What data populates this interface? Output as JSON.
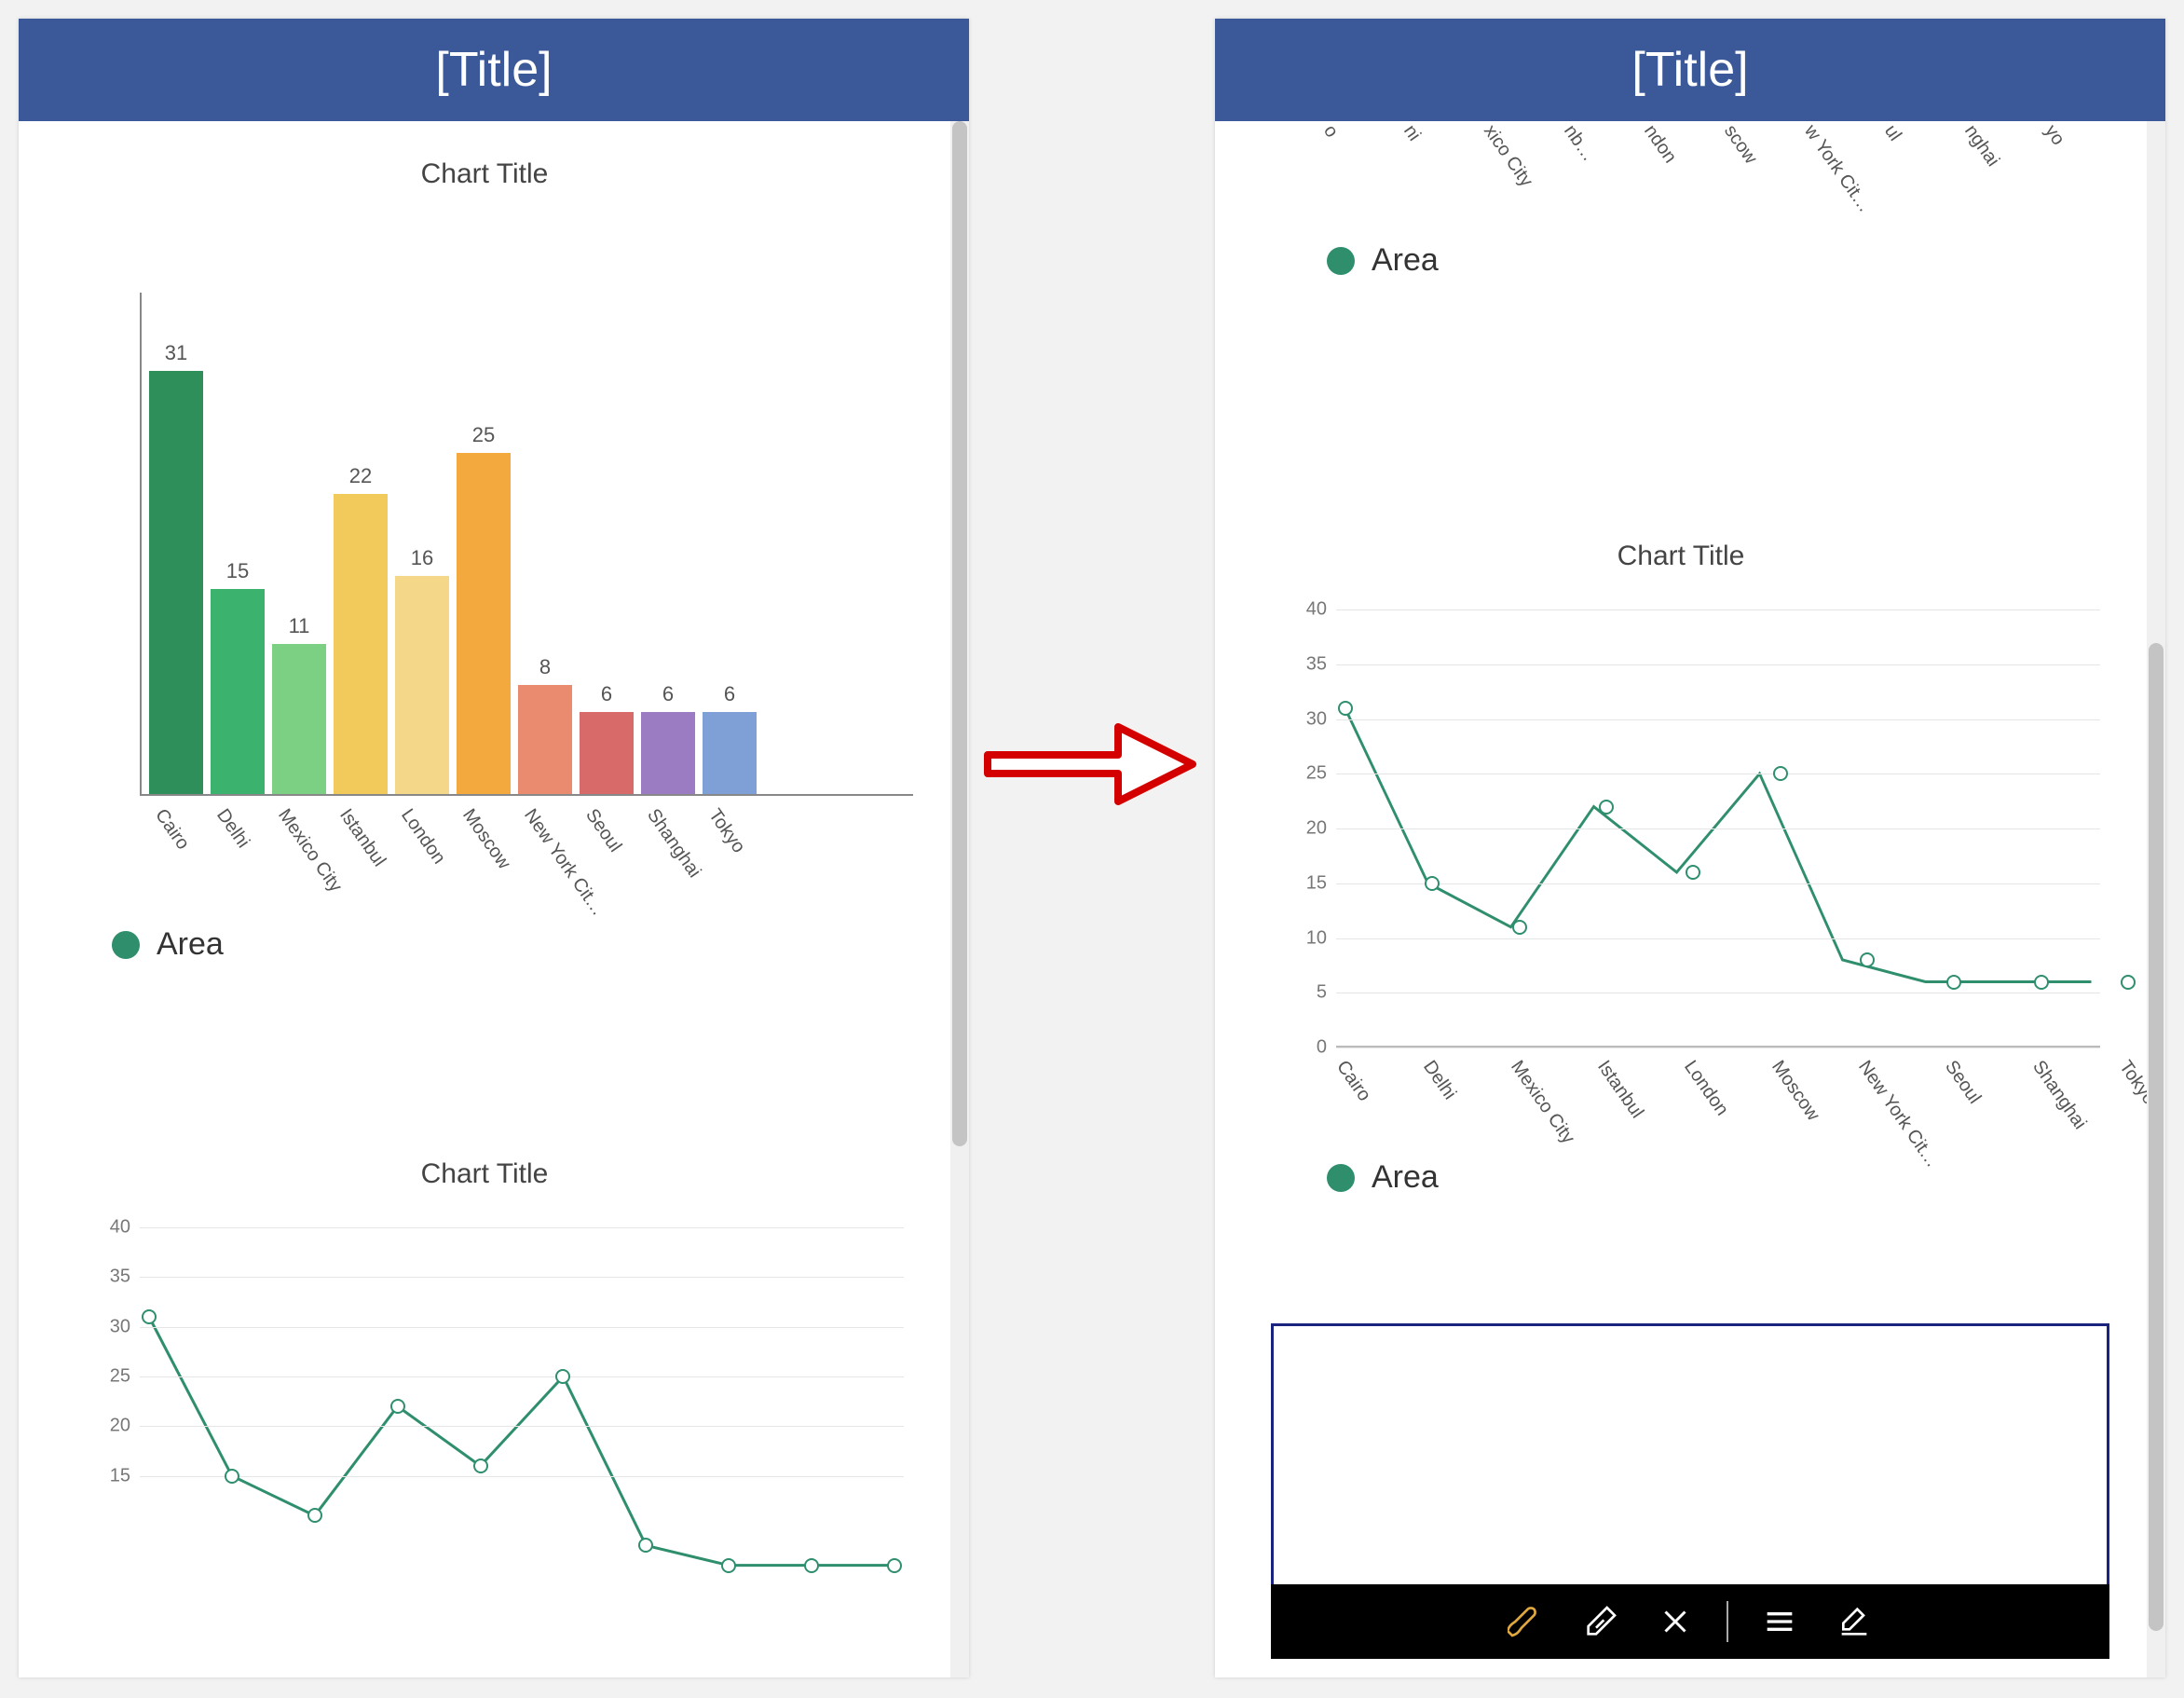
{
  "left_pane": {
    "titlebar": "[Title]",
    "bar_chart": {
      "title": "Chart Title"
    },
    "legend1": {
      "label": "Area"
    },
    "line_chart_preview": {
      "title": "Chart Title",
      "yticks": [
        "40",
        "35",
        "30",
        "25",
        "20",
        "15"
      ]
    }
  },
  "right_pane": {
    "titlebar": "[Title]",
    "top_partial_labels": [
      "o",
      "ni",
      "xico City",
      "nb…",
      "ndon",
      "scow",
      "w York Cit…",
      "ul",
      "nghai",
      "yo"
    ],
    "legend_top": {
      "label": "Area"
    },
    "line_chart": {
      "title": "Chart Title",
      "yticks": [
        "40",
        "35",
        "30",
        "25",
        "20",
        "15",
        "10",
        "5",
        "0"
      ]
    },
    "legend_bottom": {
      "label": "Area"
    },
    "toolbar": {
      "pen": "pen-icon",
      "eraser": "eraser-icon",
      "close": "close-icon",
      "lines": "lines-icon",
      "edit": "edit-icon"
    }
  },
  "chart_data": [
    {
      "type": "bar",
      "title": "Chart Title",
      "categories": [
        "Cairo",
        "Delhi",
        "Mexico City",
        "Istanbul",
        "London",
        "Moscow",
        "New York Cit…",
        "Seoul",
        "Shanghai",
        "Tokyo"
      ],
      "series": [
        {
          "name": "Area",
          "values": [
            31,
            15,
            11,
            22,
            16,
            25,
            8,
            6,
            6,
            6
          ]
        }
      ],
      "colors": [
        "#2f8f5a",
        "#3bb36e",
        "#7cd084",
        "#f2c95b",
        "#f5d789",
        "#f3a93e",
        "#ea8a6f",
        "#d96a6a",
        "#9b7bc2",
        "#7ea0d6"
      ],
      "ylim": [
        0,
        35
      ]
    },
    {
      "type": "line",
      "title": "Chart Title",
      "categories": [
        "Cairo",
        "Delhi",
        "Mexico City",
        "Istanbul",
        "London",
        "Moscow",
        "New York Cit…",
        "Seoul",
        "Shanghai",
        "Tokyo"
      ],
      "series": [
        {
          "name": "Area",
          "values": [
            31,
            15,
            11,
            22,
            16,
            25,
            8,
            6,
            6,
            6
          ]
        }
      ],
      "ylim": [
        0,
        40
      ],
      "yticks": [
        0,
        5,
        10,
        15,
        20,
        25,
        30,
        35,
        40
      ],
      "line_color": "#2f8f6d"
    }
  ]
}
